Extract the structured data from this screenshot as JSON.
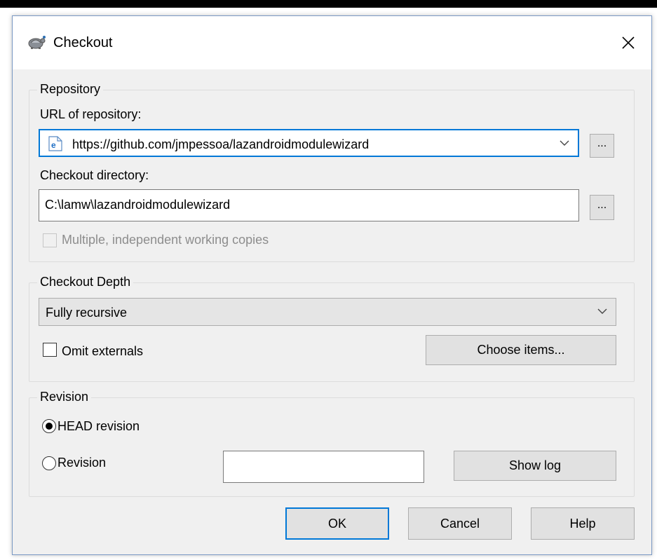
{
  "dialog": {
    "title": "Checkout",
    "close_glyph": "✕"
  },
  "repository": {
    "group_title": "Repository",
    "url_label": "URL of repository:",
    "url_value": "https://github.com/jmpessoa/lazandroidmodulewizard",
    "browse_label": "...",
    "dir_label": "Checkout directory:",
    "dir_value": "C:\\lamw\\lazandroidmodulewizard",
    "dir_browse_label": "...",
    "multiple_copies_label": "Multiple, independent working copies",
    "multiple_copies_checked": false
  },
  "depth": {
    "group_title": "Checkout Depth",
    "selected": "Fully recursive",
    "omit_externals_label": "Omit externals",
    "omit_externals_checked": false,
    "choose_items_label": "Choose items..."
  },
  "revision": {
    "group_title": "Revision",
    "head_label": "HEAD revision",
    "revision_label": "Revision",
    "selected": "HEAD revision",
    "revision_value": "",
    "show_log_label": "Show log"
  },
  "buttons": {
    "ok": "OK",
    "cancel": "Cancel",
    "help": "Help"
  },
  "colors": {
    "accent": "#0078d7",
    "dialog_bg": "#f0f0f0"
  }
}
